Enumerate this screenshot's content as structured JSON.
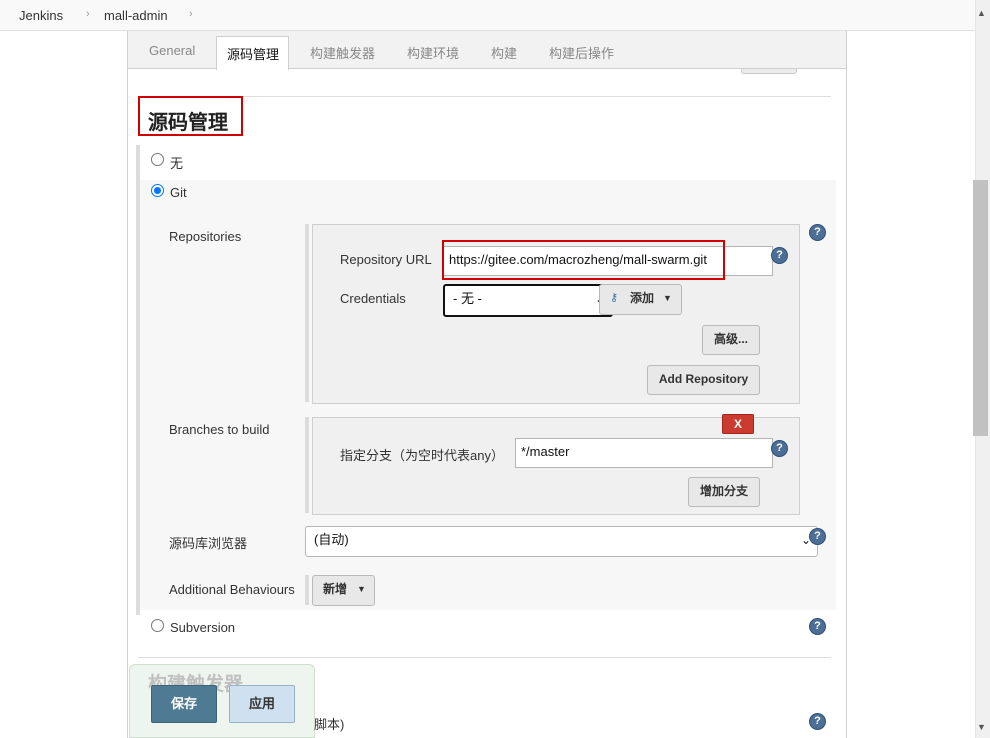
{
  "breadcrumb": {
    "items": [
      "Jenkins",
      "mall-admin"
    ]
  },
  "tabs": [
    "General",
    "源码管理",
    "构建触发器",
    "构建环境",
    "构建",
    "构建后操作"
  ],
  "active_tab": "源码管理",
  "section": {
    "title": "源码管理"
  },
  "scm": {
    "options": {
      "none": "无",
      "git": "Git",
      "subversion": "Subversion"
    },
    "selected": "Git",
    "repositories_label": "Repositories",
    "repository_url_label": "Repository URL",
    "repository_url_value": "https://gitee.com/macrozheng/mall-swarm.git",
    "credentials_label": "Credentials",
    "credentials_value": "- 无 -",
    "add_button": "添加",
    "advanced_button": "高级...",
    "add_repository_button": "Add Repository",
    "branches_label": "Branches to build",
    "delete_button": "X",
    "branch_spec_label": "指定分支（为空时代表any）",
    "branch_spec_value": "*/master",
    "add_branch_button": "增加分支",
    "browser_label": "源码库浏览器",
    "browser_value": "(自动)",
    "additional_label": "Additional Behaviours",
    "additional_button": "新增"
  },
  "triggers": {
    "title": "构建触发器",
    "partial_text": "脚本)"
  },
  "footer": {
    "save": "保存",
    "apply": "应用"
  },
  "icons": {
    "help": "question-mark-icon",
    "key": "key-icon",
    "caret": "caret-down-icon",
    "chevron": "chevron-right-icon"
  },
  "colors": {
    "highlight": "#d10000",
    "help": "#4d6f95",
    "delete": "#cc3b2f",
    "save": "#4f7a94"
  }
}
